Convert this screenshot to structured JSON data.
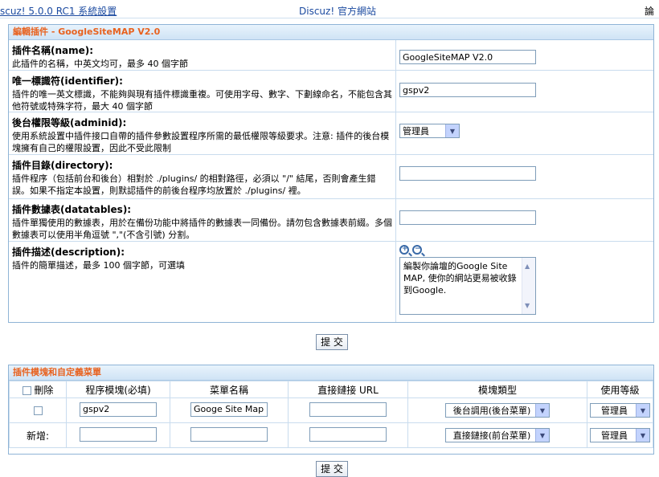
{
  "topbar": {
    "left": "scuz! 5.0.0 RC1 系統設置",
    "mid": "Discuz! 官方網站",
    "right": "論"
  },
  "edit": {
    "title": "編輯插件 - GoogleSiteMAP V2.0",
    "rows": [
      {
        "t": "插件名稱(name):",
        "d": "此插件的名稱，中英文均可，最多 40 個字節",
        "value": "GoogleSiteMAP V2.0"
      },
      {
        "t": "唯一標識符(identifier):",
        "d": "插件的唯一英文標識，不能夠與現有插件標識重複。可使用字母、數字、下劃線命名，不能包含其他符號或特殊字符，最大 40 個字節",
        "value": "gspv2"
      },
      {
        "t": "後台權限等級(adminid):",
        "d": "使用系統設置中插件接口自帶的插件參數設置程序所需的最低權限等級要求。注意: 插件的後台模塊擁有自己的權限設置，因此不受此限制",
        "value": "管理員"
      },
      {
        "t": "插件目錄(directory):",
        "d": "插件程序（包括前台和後台）相對於 ./plugins/ 的相對路徑，必須以 \"/\" 結尾，否則會產生錯誤。如果不指定本設置，則默認插件的前後台程序均放置於 ./plugins/ 裡。",
        "value": ""
      },
      {
        "t": "插件數據表(datatables):",
        "d": "插件單獨使用的數據表，用於在備份功能中將插件的數據表一同備份。請勿包含數據表前綴。多個數據表可以使用半角逗號 \",\"(不含引號) 分割。",
        "value": ""
      },
      {
        "t": "插件描述(description):",
        "d": "插件的簡單描述，最多 100 個字節，可選填",
        "value": "編製你論壇的Google Site MAP, 使你的網站更易被收錄到Google."
      }
    ],
    "submit": "提 交"
  },
  "modules": {
    "title": "插件模塊和自定義菜單",
    "headers": [
      "刪除",
      "程序模塊(必填)",
      "菜單名稱",
      "直接鏈接 URL",
      "模塊類型",
      "使用等級"
    ],
    "row1": {
      "module": "gspv2",
      "menu": "Googe Site Map Gen",
      "url": "",
      "type": "後台調用(後台菜單)",
      "level": "管理員"
    },
    "row2": {
      "label": "新增:",
      "module": "",
      "menu": "",
      "url": "",
      "type": "直接鏈接(前台菜單)",
      "level": "管理員"
    },
    "submit": "提 交"
  }
}
